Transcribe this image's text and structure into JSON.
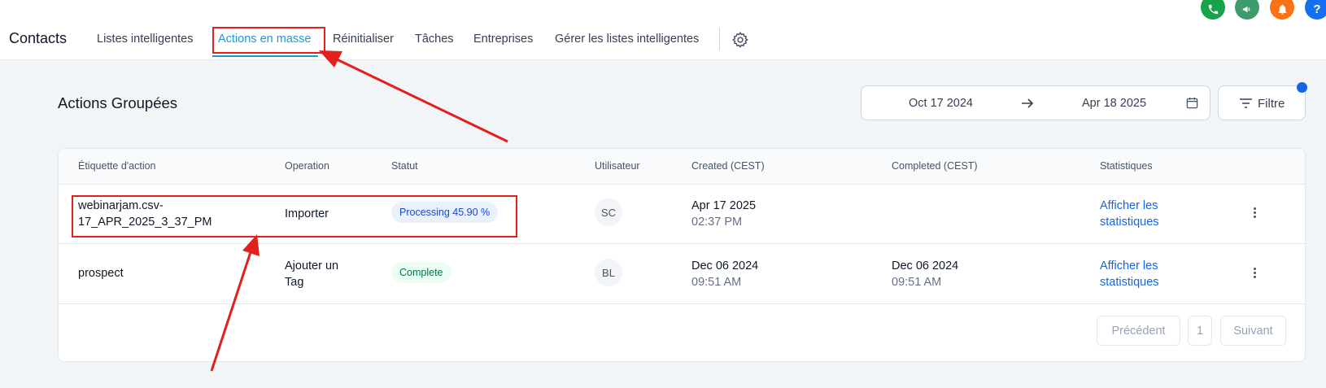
{
  "topbar": {
    "brand": "Contacts",
    "nav": [
      {
        "label": "Listes intelligentes"
      },
      {
        "label": "Actions en masse"
      },
      {
        "label": "Réinitialiser"
      },
      {
        "label": "Tâches"
      },
      {
        "label": "Entreprises"
      },
      {
        "label": "Gérer les listes intelligentes"
      }
    ],
    "header_buttons": [
      {
        "icon": "phone-icon",
        "color": "#16a34a"
      },
      {
        "icon": "megaphone-icon",
        "color": "#3f9b6c"
      },
      {
        "icon": "bell-icon",
        "color": "#f97316"
      },
      {
        "icon": "help-icon",
        "color": "#1570ef",
        "label": "?"
      }
    ]
  },
  "page": {
    "title": "Actions Groupées",
    "date_from": "Oct 17 2024",
    "date_to": "Apr 18 2025",
    "filter_label": "Filtre"
  },
  "table": {
    "headers": {
      "label": "Étiquette d'action",
      "operation": "Operation",
      "status": "Statut",
      "user": "Utilisateur",
      "created": "Created (CEST)",
      "completed": "Completed (CEST)",
      "stats": "Statistiques"
    },
    "rows": [
      {
        "label_line1": "webinarjam.csv-",
        "label_line2": "17_APR_2025_3_37_PM",
        "operation_line1": "Importer",
        "operation_line2": "",
        "status": "Processing 45.90 %",
        "status_type": "processing",
        "user_initials": "SC",
        "created_date": "Apr 17 2025",
        "created_time": "02:37 PM",
        "completed_date": "",
        "completed_time": "",
        "stats_line1": "Afficher les",
        "stats_line2": "statistiques"
      },
      {
        "label_line1": "prospect",
        "label_line2": "",
        "operation_line1": "Ajouter un",
        "operation_line2": "Tag",
        "status": "Complete",
        "status_type": "complete",
        "user_initials": "BL",
        "created_date": "Dec 06 2024",
        "created_time": "09:51 AM",
        "completed_date": "Dec 06 2024",
        "completed_time": "09:51 AM",
        "stats_line1": "Afficher les",
        "stats_line2": "statistiques"
      }
    ],
    "pagination": {
      "prev": "Précédent",
      "page": "1",
      "next": "Suivant"
    }
  },
  "colors": {
    "accent": "#1a9bd7",
    "link": "#1565e8",
    "annotation": "#e3201b"
  }
}
